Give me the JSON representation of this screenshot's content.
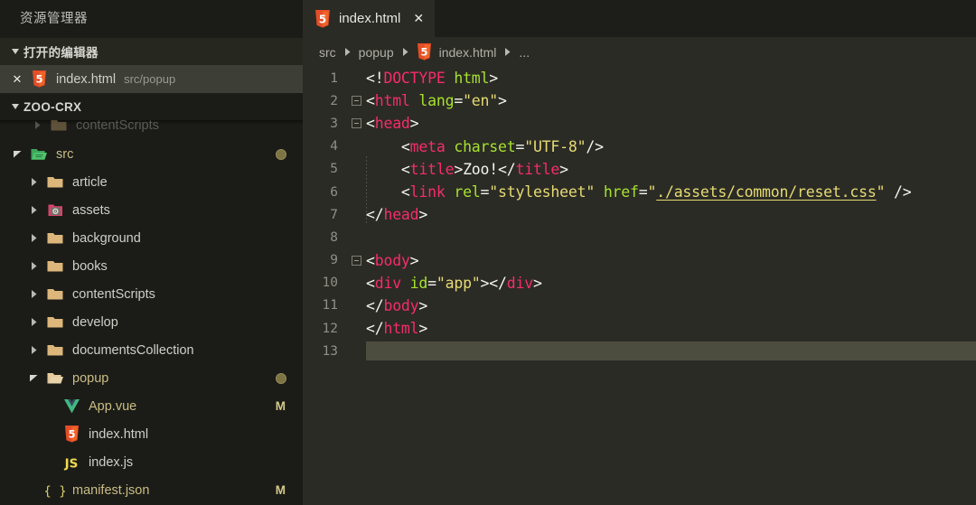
{
  "sidebar": {
    "title": "资源管理器",
    "open_editors": {
      "label": "打开的编辑器",
      "expanded_glyph": "▾",
      "items": [
        {
          "name": "index.html",
          "path": "src/popup",
          "icon": "html5-icon",
          "close": "✕",
          "selected": true
        }
      ]
    },
    "workspace": {
      "label": "ZOO-CRX",
      "clipped_row_label": "contentScripts"
    },
    "tree": [
      {
        "name": "src",
        "type": "folder-open",
        "icon": "folder-src-icon",
        "twisty": "▾",
        "indent": 1,
        "badge": "",
        "dot": true,
        "color": "tan"
      },
      {
        "name": "article",
        "type": "folder",
        "icon": "folder-icon",
        "twisty": "▸",
        "indent": 2,
        "badge": "",
        "dot": false,
        "color": "default"
      },
      {
        "name": "assets",
        "type": "folder",
        "icon": "folder-assets-icon",
        "twisty": "▸",
        "indent": 2,
        "badge": "",
        "dot": false,
        "color": "default"
      },
      {
        "name": "background",
        "type": "folder",
        "icon": "folder-icon",
        "twisty": "▸",
        "indent": 2,
        "badge": "",
        "dot": false,
        "color": "default"
      },
      {
        "name": "books",
        "type": "folder",
        "icon": "folder-icon",
        "twisty": "▸",
        "indent": 2,
        "badge": "",
        "dot": false,
        "color": "default"
      },
      {
        "name": "contentScripts",
        "type": "folder",
        "icon": "folder-icon",
        "twisty": "▸",
        "indent": 2,
        "badge": "",
        "dot": false,
        "color": "default"
      },
      {
        "name": "develop",
        "type": "folder",
        "icon": "folder-icon",
        "twisty": "▸",
        "indent": 2,
        "badge": "",
        "dot": false,
        "color": "default"
      },
      {
        "name": "documentsCollection",
        "type": "folder",
        "icon": "folder-icon",
        "twisty": "▸",
        "indent": 2,
        "badge": "",
        "dot": false,
        "color": "default"
      },
      {
        "name": "popup",
        "type": "folder-open",
        "icon": "folder-open-icon",
        "twisty": "▾",
        "indent": 2,
        "badge": "",
        "dot": true,
        "color": "tan"
      },
      {
        "name": "App.vue",
        "type": "file",
        "icon": "vue-icon",
        "twisty": "",
        "indent": 3,
        "badge": "M",
        "dot": false,
        "color": "tan"
      },
      {
        "name": "index.html",
        "type": "file",
        "icon": "html5-icon",
        "twisty": "",
        "indent": 3,
        "badge": "",
        "dot": false,
        "color": "default"
      },
      {
        "name": "index.js",
        "type": "file",
        "icon": "js-icon",
        "twisty": "",
        "indent": 3,
        "badge": "",
        "dot": false,
        "color": "default"
      },
      {
        "name": "manifest.json",
        "type": "file",
        "icon": "json-icon",
        "twisty": "",
        "indent": 2,
        "badge": "M",
        "dot": false,
        "color": "tan"
      }
    ]
  },
  "editor": {
    "tab": {
      "title": "index.html",
      "icon": "html5-icon",
      "close": "✕"
    },
    "breadcrumb": [
      {
        "label": "src",
        "icon": ""
      },
      {
        "label": "popup",
        "icon": ""
      },
      {
        "label": "index.html",
        "icon": "html5-icon"
      },
      {
        "label": "...",
        "icon": ""
      }
    ],
    "breadcrumb_separator": "▸",
    "lines": [
      {
        "n": "1",
        "fold": false,
        "tokens": [
          {
            "t": "<!",
            "c": "punct"
          },
          {
            "t": "DOCTYPE",
            "c": "tag"
          },
          {
            "t": " ",
            "c": "txt"
          },
          {
            "t": "html",
            "c": "attr"
          },
          {
            "t": ">",
            "c": "punct"
          }
        ]
      },
      {
        "n": "2",
        "fold": true,
        "tokens": [
          {
            "t": "<",
            "c": "punct"
          },
          {
            "t": "html",
            "c": "tag"
          },
          {
            "t": " ",
            "c": "txt"
          },
          {
            "t": "lang",
            "c": "attr"
          },
          {
            "t": "=",
            "c": "punct"
          },
          {
            "t": "\"en\"",
            "c": "str"
          },
          {
            "t": ">",
            "c": "punct"
          }
        ]
      },
      {
        "n": "3",
        "fold": true,
        "tokens": [
          {
            "t": "<",
            "c": "punct"
          },
          {
            "t": "head",
            "c": "tag"
          },
          {
            "t": ">",
            "c": "punct"
          }
        ]
      },
      {
        "n": "4",
        "fold": false,
        "tokens": [
          {
            "t": "    <",
            "c": "punct"
          },
          {
            "t": "meta",
            "c": "tag"
          },
          {
            "t": " ",
            "c": "txt"
          },
          {
            "t": "charset",
            "c": "attr"
          },
          {
            "t": "=",
            "c": "punct"
          },
          {
            "t": "\"UTF-8\"",
            "c": "str"
          },
          {
            "t": "/>",
            "c": "punct"
          }
        ]
      },
      {
        "n": "5",
        "fold": false,
        "tokens": [
          {
            "t": "    <",
            "c": "punct"
          },
          {
            "t": "title",
            "c": "tag"
          },
          {
            "t": ">",
            "c": "punct"
          },
          {
            "t": "Zoo!",
            "c": "txt"
          },
          {
            "t": "</",
            "c": "punct"
          },
          {
            "t": "title",
            "c": "tag"
          },
          {
            "t": ">",
            "c": "punct"
          }
        ]
      },
      {
        "n": "6",
        "fold": false,
        "tokens": [
          {
            "t": "    <",
            "c": "punct"
          },
          {
            "t": "link",
            "c": "tag"
          },
          {
            "t": " ",
            "c": "txt"
          },
          {
            "t": "rel",
            "c": "attr"
          },
          {
            "t": "=",
            "c": "punct"
          },
          {
            "t": "\"stylesheet\"",
            "c": "str"
          },
          {
            "t": " ",
            "c": "txt"
          },
          {
            "t": "href",
            "c": "attr"
          },
          {
            "t": "=",
            "c": "punct"
          },
          {
            "t": "\"",
            "c": "str"
          },
          {
            "t": "./assets/common/reset.css",
            "c": "link"
          },
          {
            "t": "\"",
            "c": "str"
          },
          {
            "t": " />",
            "c": "punct"
          }
        ]
      },
      {
        "n": "7",
        "fold": false,
        "tokens": [
          {
            "t": "</",
            "c": "punct"
          },
          {
            "t": "head",
            "c": "tag"
          },
          {
            "t": ">",
            "c": "punct"
          }
        ]
      },
      {
        "n": "8",
        "fold": false,
        "tokens": []
      },
      {
        "n": "9",
        "fold": true,
        "tokens": [
          {
            "t": "<",
            "c": "punct"
          },
          {
            "t": "body",
            "c": "tag"
          },
          {
            "t": ">",
            "c": "punct"
          }
        ]
      },
      {
        "n": "10",
        "fold": false,
        "tokens": [
          {
            "t": "<",
            "c": "punct"
          },
          {
            "t": "div",
            "c": "tag"
          },
          {
            "t": " ",
            "c": "txt"
          },
          {
            "t": "id",
            "c": "attr"
          },
          {
            "t": "=",
            "c": "punct"
          },
          {
            "t": "\"app\"",
            "c": "str"
          },
          {
            "t": ">",
            "c": "punct"
          },
          {
            "t": "</",
            "c": "punct"
          },
          {
            "t": "div",
            "c": "tag"
          },
          {
            "t": ">",
            "c": "punct"
          }
        ]
      },
      {
        "n": "11",
        "fold": false,
        "tokens": [
          {
            "t": "</",
            "c": "punct"
          },
          {
            "t": "body",
            "c": "tag"
          },
          {
            "t": ">",
            "c": "punct"
          }
        ]
      },
      {
        "n": "12",
        "fold": false,
        "tokens": [
          {
            "t": "</",
            "c": "punct"
          },
          {
            "t": "html",
            "c": "tag"
          },
          {
            "t": ">",
            "c": "punct"
          }
        ]
      },
      {
        "n": "13",
        "fold": false,
        "tokens": [],
        "selected": true
      }
    ]
  },
  "colors": {
    "sidebar_bg": "#1b1c18",
    "editor_bg": "#2b2b25",
    "tabbar_bg": "#1d1e1a",
    "selection": "#5a5a4a",
    "tag": "#f52c6a",
    "attr": "#a6e22e",
    "string": "#e6db74",
    "text": "#f5f5ef",
    "html5_icon": "#e44d26",
    "vue_icon": "#41b883",
    "js_icon": "#f0db4f",
    "folder": "#dcb67a",
    "badge_modified": "#d4c98a"
  }
}
